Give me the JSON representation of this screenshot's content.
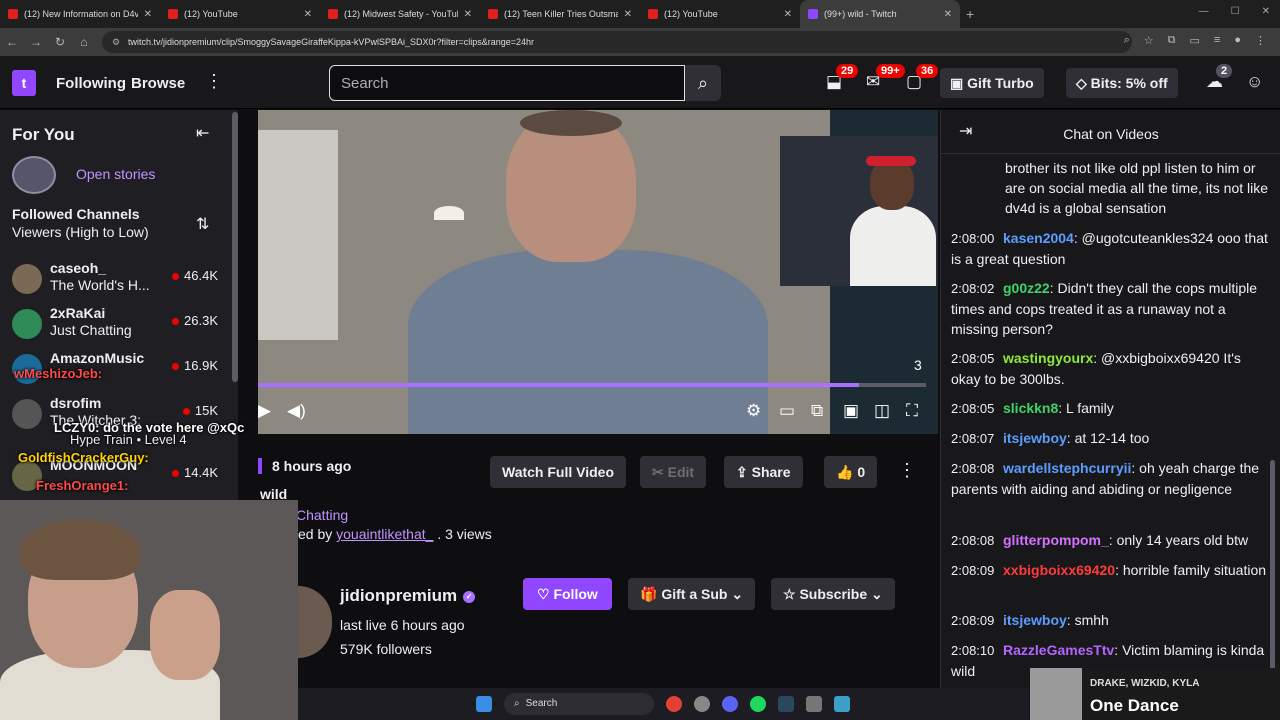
{
  "browser": {
    "tabs": [
      {
        "title": "(12) New Information on D4vd",
        "icon": "youtube-icon"
      },
      {
        "title": "(12) YouTube",
        "icon": "youtube-icon"
      },
      {
        "title": "(12) Midwest Safety - YouTube",
        "icon": "youtube-icon"
      },
      {
        "title": "(12) Teen Killer Tries Outsmarting",
        "icon": "youtube-icon"
      },
      {
        "title": "(12) YouTube",
        "icon": "youtube-icon"
      },
      {
        "title": "(99+) wild - Twitch",
        "icon": "twitch-icon",
        "active": true
      }
    ],
    "url": "twitch.tv/jidionpremium/clip/SmoggySavageGiraffeKippa-kVPwlSPBAi_SDX0r?filter=clips&range=24hr"
  },
  "nav": {
    "following": "Following",
    "browse": "Browse",
    "search_placeholder": "Search",
    "notif1": "29",
    "notif2": "99+",
    "notif3": "36",
    "gift_turbo": "Gift Turbo",
    "bits": "Bits: 5% off",
    "bits_badge": "2"
  },
  "sidebar": {
    "title": "For You",
    "stories": "Open stories",
    "section": "Followed Channels",
    "sort": "Viewers (High to Low)",
    "channels": [
      {
        "name": "caseoh_",
        "game": "The World's H...",
        "viewers": "46.4K"
      },
      {
        "name": "2xRaKai",
        "game": "Just Chatting",
        "viewers": "26.3K"
      },
      {
        "name": "AmazonMusic",
        "game": "",
        "viewers": "16.9K"
      },
      {
        "name": "dsrofim",
        "game": "The Witcher 3:",
        "viewers": "15K"
      },
      {
        "name": "MOONMOON",
        "game": "",
        "viewers": "14.4K"
      }
    ]
  },
  "overlay": {
    "line1": "wMeshizoJeb:",
    "line2": "LCZY0: do the vote here @xQc",
    "line3": "Hype Train • Level 4",
    "line4": "GoldfishCrackerGuy:",
    "line5": "FreshOrange1:"
  },
  "player": {
    "count": "3",
    "progress": 0.9
  },
  "clip": {
    "time": "8 hours ago",
    "title": "wild",
    "category": "Chatting",
    "clipped_by_prefix": "ed by",
    "clipper": "youaintlikethat_",
    "views": ". 3 views",
    "watch_full": "Watch Full Video",
    "edit": "Edit",
    "share": "Share",
    "likes": "0"
  },
  "channel": {
    "name": "jidionpremium",
    "last_live": "last live 6 hours ago",
    "followers": "579K followers",
    "follow": "Follow",
    "gift_sub": "Gift a Sub",
    "subscribe": "Subscribe"
  },
  "chat": {
    "title": "Chat on Videos",
    "messages": [
      {
        "ts": "",
        "user": "",
        "color": "#efeff1",
        "text": "brother its not like old ppl listen to him or are on social media all the time, its not like dv4d is a global sensation"
      },
      {
        "ts": "2:08:00",
        "user": "kasen2004",
        "color": "#5c9dff",
        "text": "@ugotcuteankles324 ooo that is a great question"
      },
      {
        "ts": "2:08:02",
        "user": "g00z22",
        "color": "#3ed26a",
        "text": "Didn't they call the cops multiple times and cops treated it as a runaway not a missing person?"
      },
      {
        "ts": "2:08:05",
        "user": "wastingyourx",
        "color": "#8de83b",
        "text": "@xxbigboixx69420 It's okay to be 300lbs."
      },
      {
        "ts": "2:08:05",
        "user": "slickkn8",
        "color": "#3ed26a",
        "text": "L family"
      },
      {
        "ts": "2:08:07",
        "user": "itsjewboy",
        "color": "#5c9dff",
        "text": "at 12-14 too"
      },
      {
        "ts": "2:08:08",
        "user": "wardellstephcurryii",
        "color": "#5c9dff",
        "text": "oh yeah charge the parents with aiding and abiding or negligence"
      },
      {
        "ts": "2:08:08",
        "user": "glitterpompom_",
        "color": "#d473ff",
        "text": "only 14 years old btw"
      },
      {
        "ts": "2:08:09",
        "user": "xxbigboixx69420",
        "color": "#ff3b3b",
        "text": "horrible family situation"
      },
      {
        "ts": "2:08:09",
        "user": "itsjewboy",
        "color": "#5c9dff",
        "text": "smhh"
      },
      {
        "ts": "2:08:10",
        "user": "RazzleGamesTtv",
        "color": "#b565ff",
        "text": "Victim blaming is kinda wild"
      }
    ]
  },
  "taskbar": {
    "search": "Search"
  },
  "now_playing": {
    "artist": "DRAKE, WIZKID, KYLA",
    "title": "One Dance"
  }
}
